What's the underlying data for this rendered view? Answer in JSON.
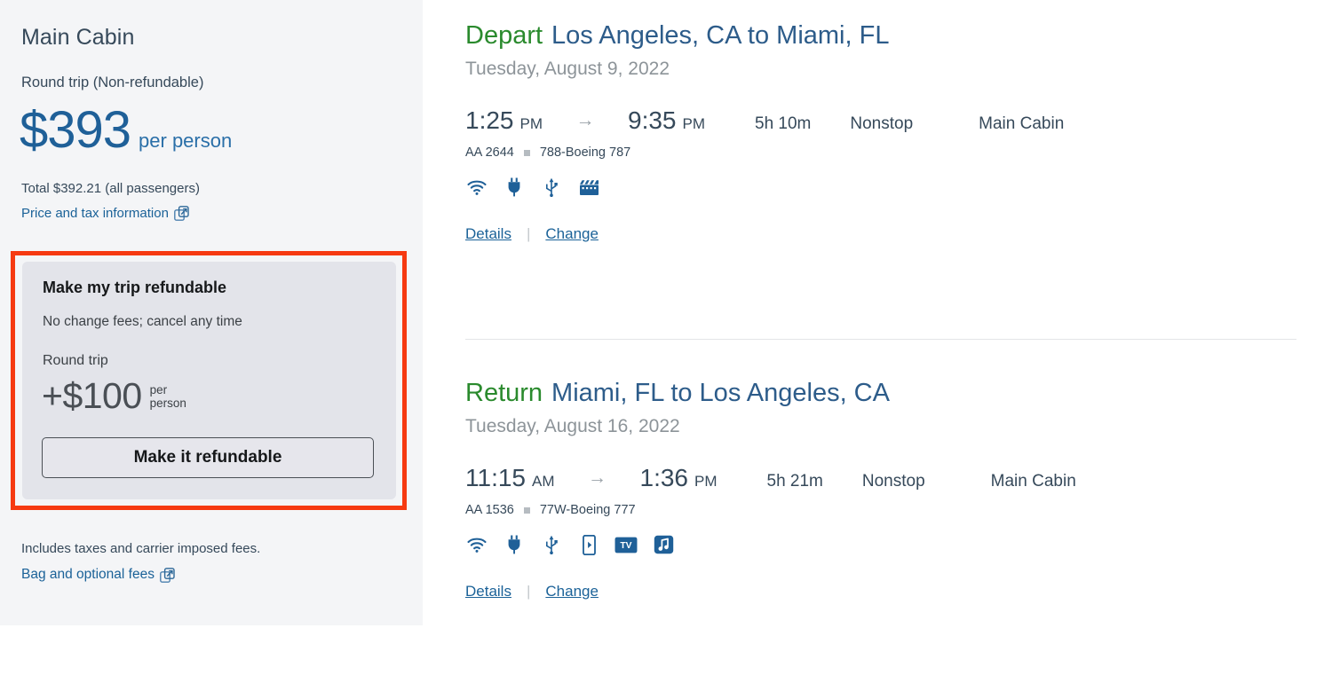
{
  "sidebar": {
    "cabin_title": "Main Cabin",
    "trip_type": "Round trip (Non-refundable)",
    "price_amount": "$393",
    "price_unit": "per person",
    "total_line": "Total $392.21 (all passengers)",
    "price_tax_link": "Price and tax information",
    "price_tax_icon": "external-link-icon",
    "includes_line": "Includes taxes and carrier imposed fees.",
    "bag_link": "Bag and optional fees",
    "bag_link_icon": "external-link-icon",
    "refund_offer": {
      "title": "Make my trip refundable",
      "subtitle": "No change fees; cancel any time",
      "trip_label": "Round trip",
      "upcharge": "+$100",
      "per_person": "per\nperson",
      "per_person_line1": "per",
      "per_person_line2": "person",
      "button_label": "Make it refundable"
    }
  },
  "highlight": {
    "color": "#f63a11",
    "target": "refund-offer-card"
  },
  "colors": {
    "price_blue": "#1f6098",
    "link_blue": "#1b6298",
    "depart_green": "#2a8a2d",
    "route_blue": "#2d5c8a",
    "body_slate": "#36495a",
    "muted_gray": "#8d9499",
    "sidebar_bg": "#f4f5f7",
    "card_bg": "#e3e4ea",
    "highlight_red": "#f63a11"
  },
  "itinerary": [
    {
      "direction": "Depart",
      "route": "Los Angeles, CA to Miami, FL",
      "date": "Tuesday, August 9, 2022",
      "depart_time": "1:25",
      "depart_meridiem": "PM",
      "arrive_time": "9:35",
      "arrive_meridiem": "PM",
      "duration": "5h 10m",
      "stops": "Nonstop",
      "cabin": "Main Cabin",
      "flight_number": "AA 2644",
      "aircraft": "788-Boeing 787",
      "amenities": [
        "wifi-icon",
        "power-outlet-icon",
        "usb-port-icon",
        "movies-icon"
      ],
      "details_label": "Details",
      "change_label": "Change",
      "divider_label": "|"
    },
    {
      "direction": "Return",
      "route": "Miami, FL to Los Angeles, CA",
      "date": "Tuesday, August 16, 2022",
      "depart_time": "11:15",
      "depart_meridiem": "AM",
      "arrive_time": "1:36",
      "arrive_meridiem": "PM",
      "duration": "5h 21m",
      "stops": "Nonstop",
      "cabin": "Main Cabin",
      "flight_number": "AA 1536",
      "aircraft": "77W-Boeing 777",
      "amenities": [
        "wifi-icon",
        "power-outlet-icon",
        "usb-port-icon",
        "device-streaming-icon",
        "tv-icon",
        "music-icon"
      ],
      "details_label": "Details",
      "change_label": "Change",
      "divider_label": "|"
    }
  ]
}
